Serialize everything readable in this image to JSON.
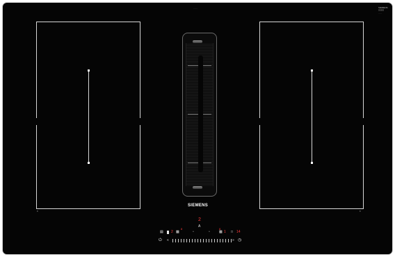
{
  "brand": "SIEMENS",
  "top_label": "······",
  "logo_lines": [
    "SIEMENS",
    "☰☰☰",
    "·····"
  ],
  "zone_left_marker": "≡",
  "zone_right_marker": "≡",
  "ventilation": {
    "level_display": "2",
    "auto_label": "A"
  },
  "controls": {
    "left_display_1": "2",
    "left_display_2": "8",
    "right_display_1": "8",
    "right_display_2": "1",
    "timer_display": "14",
    "power_symbol": "⏻",
    "slider_start": "«",
    "slider_end": "»",
    "timer_symbol": "◷"
  },
  "colors": {
    "glass": "#050505",
    "zone_line": "#d8d8d8",
    "display_red": "#ff3b3b"
  }
}
